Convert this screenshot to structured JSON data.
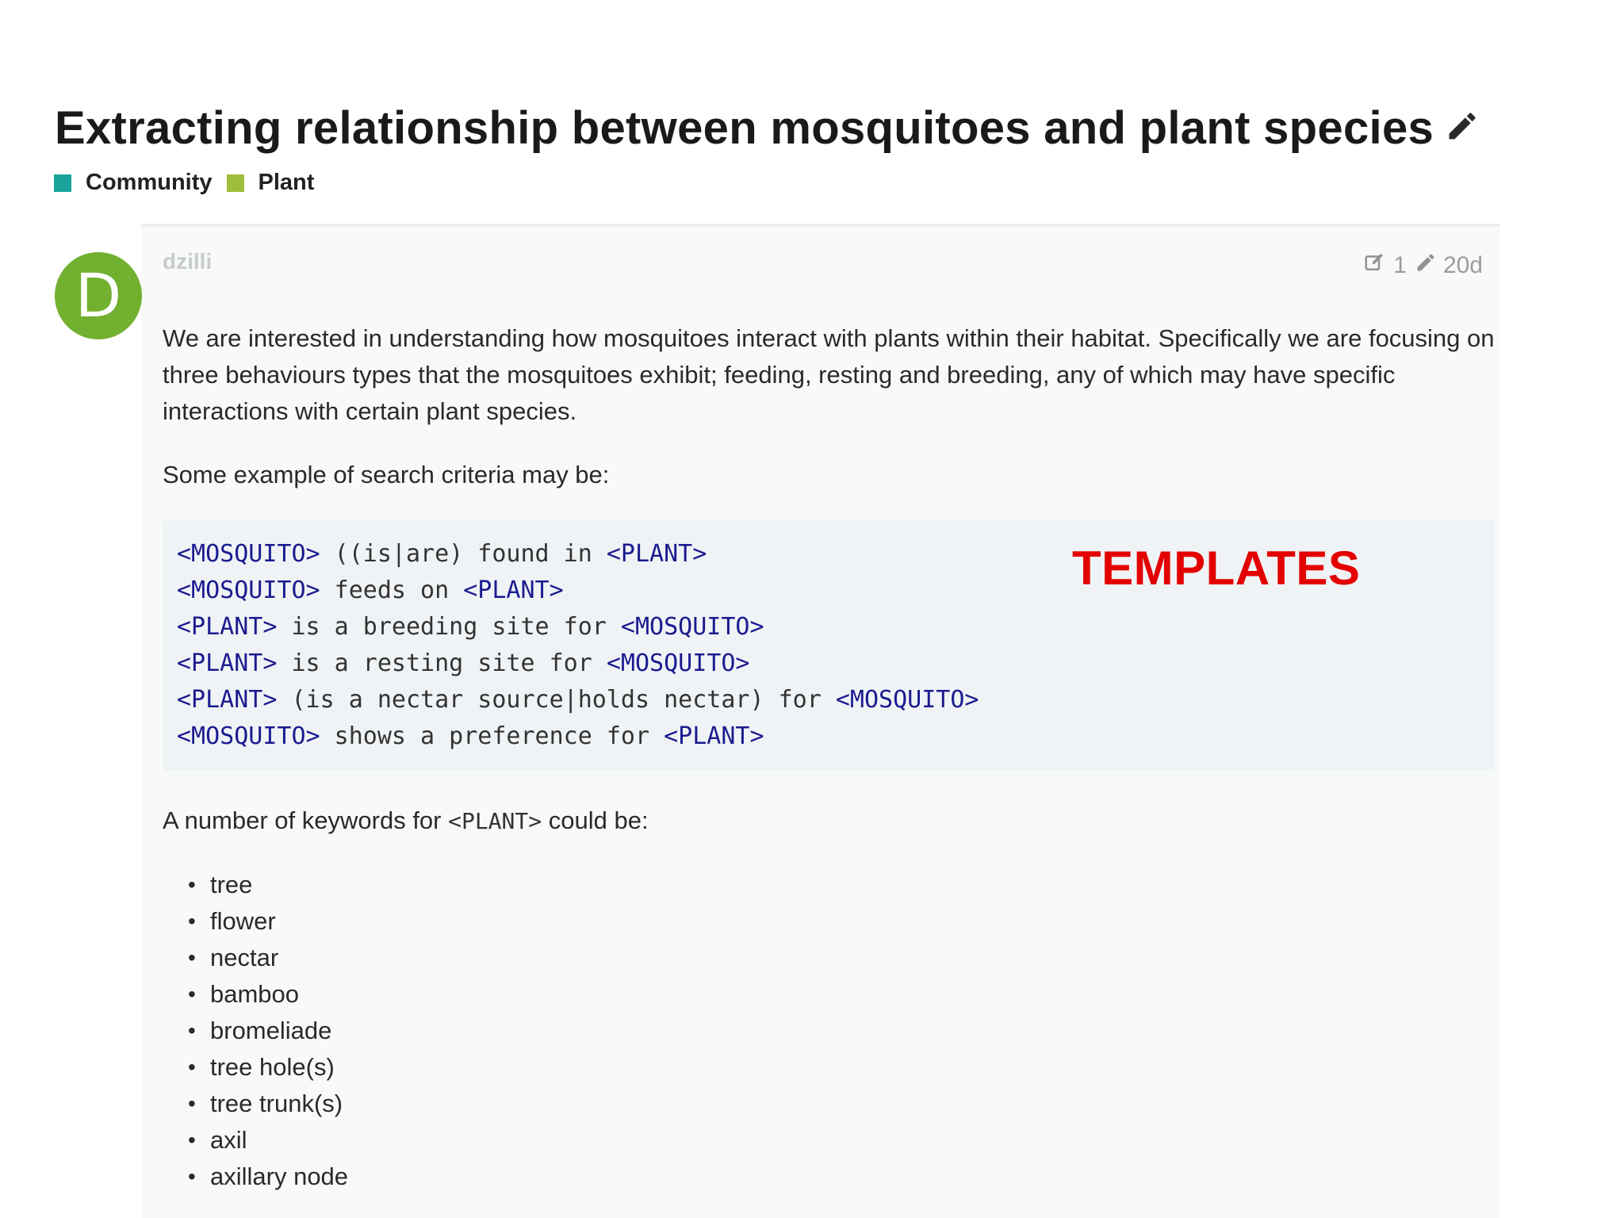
{
  "topic": {
    "title": "Extracting relationship between mosquitoes and plant species",
    "categories": [
      {
        "label": "Community",
        "color": "#1aa39a"
      },
      {
        "label": "Plant",
        "color": "#9ebd3a"
      }
    ]
  },
  "post": {
    "avatar_letter": "D",
    "avatar_color": "#72b02f",
    "username": "dzilli",
    "edit_count": "1",
    "age": "20d",
    "intro": "We are interested in understanding how mosquitoes interact with plants within their habitat. Specifically we are focusing on three behaviours types that the mosquitoes exhibit; feeding, resting and breeding, any of which may have specific interactions with certain plant species.",
    "search_lead": "Some example of search criteria may be:",
    "templates": [
      [
        {
          "t": "<MOSQUITO>",
          "tag": true
        },
        {
          "t": " ((is|are) found in ",
          "tag": false
        },
        {
          "t": "<PLANT>",
          "tag": true
        }
      ],
      [
        {
          "t": "<MOSQUITO>",
          "tag": true
        },
        {
          "t": " feeds on ",
          "tag": false
        },
        {
          "t": "<PLANT>",
          "tag": true
        }
      ],
      [
        {
          "t": "<PLANT>",
          "tag": true
        },
        {
          "t": " is a breeding site for ",
          "tag": false
        },
        {
          "t": "<MOSQUITO>",
          "tag": true
        }
      ],
      [
        {
          "t": "<PLANT>",
          "tag": true
        },
        {
          "t": " is a resting site for ",
          "tag": false
        },
        {
          "t": "<MOSQUITO>",
          "tag": true
        }
      ],
      [
        {
          "t": "<PLANT>",
          "tag": true
        },
        {
          "t": " (is a nectar source|holds nectar) for ",
          "tag": false
        },
        {
          "t": "<MOSQUITO>",
          "tag": true
        }
      ],
      [
        {
          "t": "<MOSQUITO>",
          "tag": true
        },
        {
          "t": " shows a preference for ",
          "tag": false
        },
        {
          "t": "<PLANT>",
          "tag": true
        }
      ]
    ],
    "keywords_lead_before": "A number of keywords for ",
    "keywords_lead_code": "<PLANT>",
    "keywords_lead_after": " could be:",
    "keywords": [
      "tree",
      "flower",
      "nectar",
      "bamboo",
      "bromeliade",
      "tree hole(s)",
      "tree trunk(s)",
      "axil",
      "axillary node"
    ]
  },
  "annotation": {
    "label": "TEMPLATES",
    "color": "#e30000"
  }
}
